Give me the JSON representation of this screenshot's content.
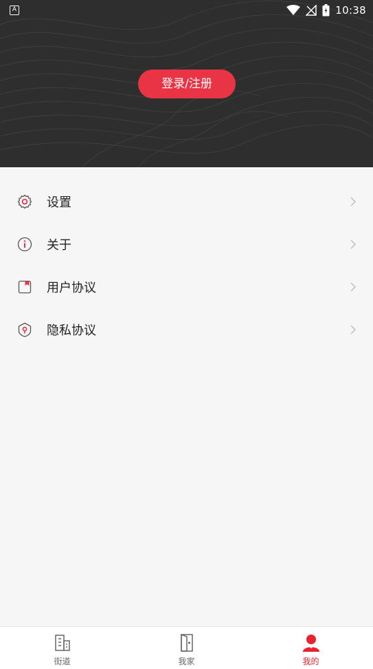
{
  "status_bar": {
    "time": "10:38",
    "app_badge": "A"
  },
  "header": {
    "login_label": "登录/注册"
  },
  "menu": {
    "items": [
      {
        "label": "设置",
        "icon": "gear-icon"
      },
      {
        "label": "关于",
        "icon": "info-icon"
      },
      {
        "label": "用户协议",
        "icon": "document-icon"
      },
      {
        "label": "隐私协议",
        "icon": "shield-lock-icon"
      }
    ]
  },
  "tabbar": {
    "tabs": [
      {
        "label": "街道",
        "icon": "building-icon",
        "active": false
      },
      {
        "label": "我家",
        "icon": "door-icon",
        "active": false
      },
      {
        "label": "我的",
        "icon": "user-icon",
        "active": true
      }
    ]
  },
  "colors": {
    "accent": "#e83444",
    "header_bg": "#2e2e2e",
    "page_bg": "#f6f6f6"
  }
}
